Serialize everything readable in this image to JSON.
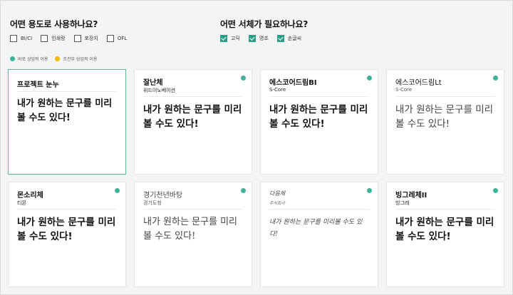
{
  "filters": {
    "usage": {
      "title": "어떤 용도로 사용하나요?",
      "options": [
        {
          "label": "BI/CI",
          "checked": false
        },
        {
          "label": "인쇄랑",
          "checked": false
        },
        {
          "label": "포장지",
          "checked": false
        },
        {
          "label": "OFL",
          "checked": false
        }
      ]
    },
    "style": {
      "title": "어떤 서체가 필요하나요?",
      "options": [
        {
          "label": "고딕",
          "checked": true
        },
        {
          "label": "명조",
          "checked": true
        },
        {
          "label": "손글씨",
          "checked": true
        }
      ]
    }
  },
  "legend": [
    {
      "label": "바로 상업적 이용",
      "color": "#3db39a"
    },
    {
      "label": "조건부 상업적 이용",
      "color": "#f5b800"
    }
  ],
  "cards": [
    {
      "name": "프로젝트 눈누",
      "maker": "",
      "sample": "내가 원하는 문구를 미리 볼 수도 있다!",
      "dot": ""
    },
    {
      "name": "잘난체",
      "maker": "위드이노베이션",
      "sample": "내가 원하는 문구를 미리볼 수도 있다!",
      "dot": "#3db39a"
    },
    {
      "name": "에스코어드림BI",
      "maker": "S-Core",
      "sample": "내가 원하는 문구를 미리볼 수도 있다!",
      "dot": "#3db39a"
    },
    {
      "name": "에스코어드림Lt",
      "maker": "S-Core",
      "sample": "내가 원하는 문구를 미리볼 수도 있다!",
      "dot": "#3db39a"
    },
    {
      "name": "몬소리체",
      "maker": "티몬",
      "sample": "내가 원하는 문구를 미리볼 수도 있다!",
      "dot": "#3db39a"
    },
    {
      "name": "경기천년바탕",
      "maker": "경기도청",
      "sample": "내가 원하는 문구를 미리볼 수도 있다!",
      "dot": "#3db39a"
    },
    {
      "name": "다음체",
      "maker": "주식회사",
      "sample": "내가 원하는 문구를 미리볼 수도 있다!",
      "dot": "#3db39a"
    },
    {
      "name": "빙그레체II",
      "maker": "빙그레",
      "sample": "내가 원하는 문구를 미리볼 수도 있다!",
      "dot": "#3db39a"
    }
  ]
}
